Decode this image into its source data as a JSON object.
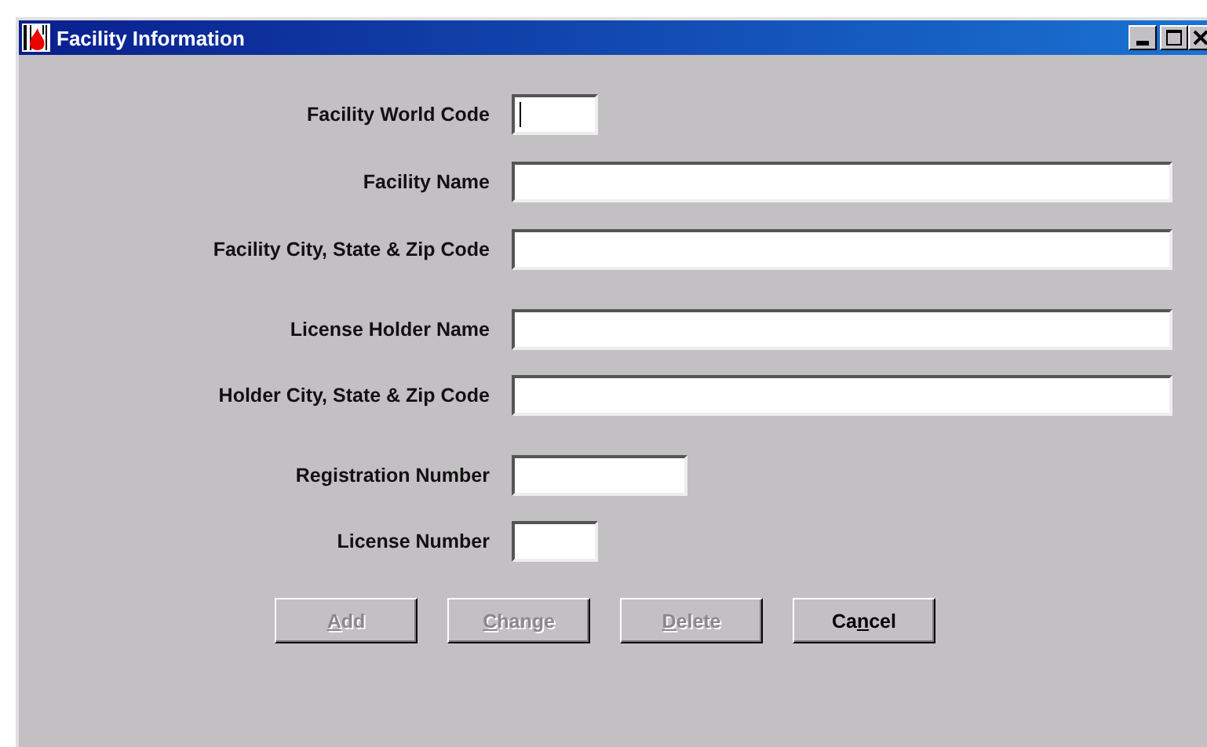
{
  "window": {
    "title": "Facility Information"
  },
  "sections": [
    {
      "fields": [
        {
          "label": "Facility World Code",
          "kind": "short",
          "focused": true
        },
        {
          "label": "Facility Name",
          "kind": "wide",
          "focused": false
        },
        {
          "label": "Facility City, State & Zip Code",
          "kind": "wide",
          "focused": false
        }
      ]
    },
    {
      "fields": [
        {
          "label": "License Holder Name",
          "kind": "wide",
          "focused": false
        },
        {
          "label": "Holder City, State & Zip Code",
          "kind": "wide",
          "focused": false
        }
      ]
    },
    {
      "fields": [
        {
          "label": "Registration Number",
          "kind": "medium",
          "focused": false
        },
        {
          "label": "License Number",
          "kind": "short",
          "focused": false
        }
      ]
    }
  ],
  "buttons": [
    {
      "key": "A",
      "after": "dd",
      "disabled": true
    },
    {
      "key": "C",
      "after": "hange",
      "disabled": true
    },
    {
      "key": "D",
      "after": "elete",
      "disabled": true
    },
    {
      "before": "Ca",
      "key": "n",
      "after": "cel",
      "disabled": false
    }
  ]
}
